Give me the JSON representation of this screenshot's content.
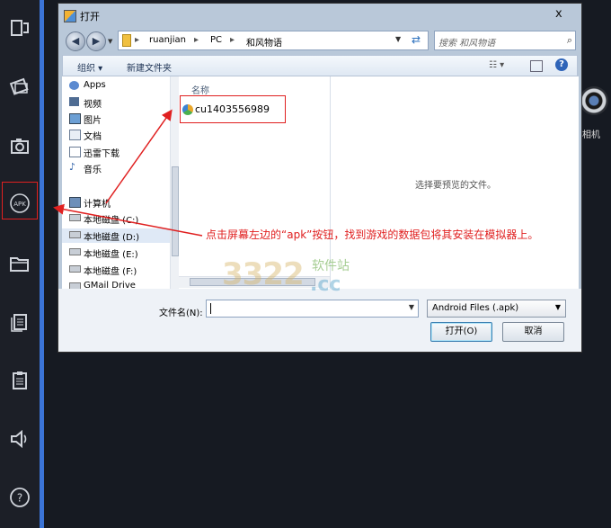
{
  "leftbar": {
    "items": [
      {
        "name": "multi-window-icon"
      },
      {
        "name": "rotate-icon"
      },
      {
        "name": "camera-icon"
      },
      {
        "name": "apk-icon",
        "label": "APK"
      },
      {
        "name": "folder-icon"
      },
      {
        "name": "copy-icon"
      },
      {
        "name": "clipboard-icon"
      },
      {
        "name": "volume-icon"
      },
      {
        "name": "help-icon",
        "label": "?"
      }
    ]
  },
  "emulator": {
    "camera_label": "相机"
  },
  "dialog": {
    "title": "打开",
    "close": "x",
    "breadcrumb": [
      "ruanjian",
      "PC",
      "和风物语"
    ],
    "search_placeholder": "搜索 和风物语",
    "toolbar": {
      "organize": "组织 ▾",
      "new_folder": "新建文件夹"
    },
    "nav_items": [
      {
        "label": "Apps",
        "icon": "apps-icon"
      },
      {
        "label": "视频",
        "icon": "video-icon"
      },
      {
        "label": "图片",
        "icon": "image-icon"
      },
      {
        "label": "文档",
        "icon": "document-icon"
      },
      {
        "label": "迅雷下载",
        "icon": "download-icon"
      },
      {
        "label": "音乐",
        "icon": "music-icon"
      },
      {
        "label": "计算机",
        "icon": "computer-icon"
      },
      {
        "label": "本地磁盘 (C:)",
        "icon": "drive-icon"
      },
      {
        "label": "本地磁盘 (D:)",
        "icon": "drive-icon"
      },
      {
        "label": "本地磁盘 (E:)",
        "icon": "drive-icon"
      },
      {
        "label": "本地磁盘 (F:)",
        "icon": "drive-icon"
      },
      {
        "label": "GMail Drive",
        "icon": "drive-icon"
      }
    ],
    "column_header": "名称",
    "file": {
      "name": "cu1403556989",
      "icon": "apk-file-icon"
    },
    "preview_text": "选择要预览的文件。",
    "filename_label": "文件名(N):",
    "filename_value": "",
    "filter": "Android Files (.apk)",
    "open_button": "打开(O)",
    "cancel_button": "取消"
  },
  "annotation": {
    "text": "点击屏幕左边的“apk”按钮，找到游戏的数据包将其安装在模拟器上。",
    "color": "#e02020"
  },
  "watermark": {
    "logo": "3322",
    "site": "软件站",
    "domain": ".cc"
  }
}
